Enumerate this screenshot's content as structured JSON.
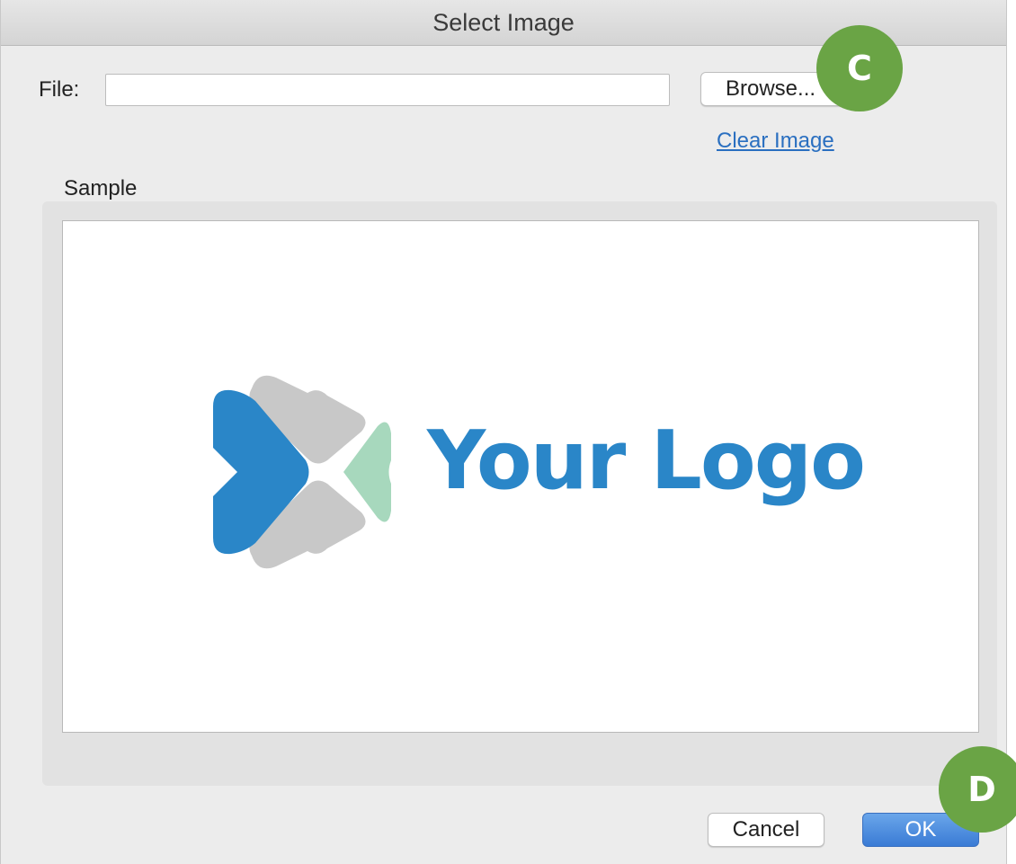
{
  "window": {
    "title": "Select Image"
  },
  "file": {
    "label": "File:",
    "value": "",
    "placeholder": ""
  },
  "buttons": {
    "browse": "Browse...",
    "cancel": "Cancel",
    "ok": "OK"
  },
  "links": {
    "clear_image": "Clear Image"
  },
  "sample": {
    "label": "Sample",
    "logo_text": "Your Logo",
    "logo_icon": "logo-mark-icon",
    "logo_colors": {
      "blue": "#2a86c8",
      "gray": "#c8c8c8",
      "green": "#a7d8bd"
    }
  },
  "callouts": {
    "c": "C",
    "d": "D",
    "color": "#6aa445"
  },
  "colors": {
    "ok_button": "#3a7bd5",
    "link": "#2a6fc0",
    "dialog_bg": "#ececec"
  }
}
